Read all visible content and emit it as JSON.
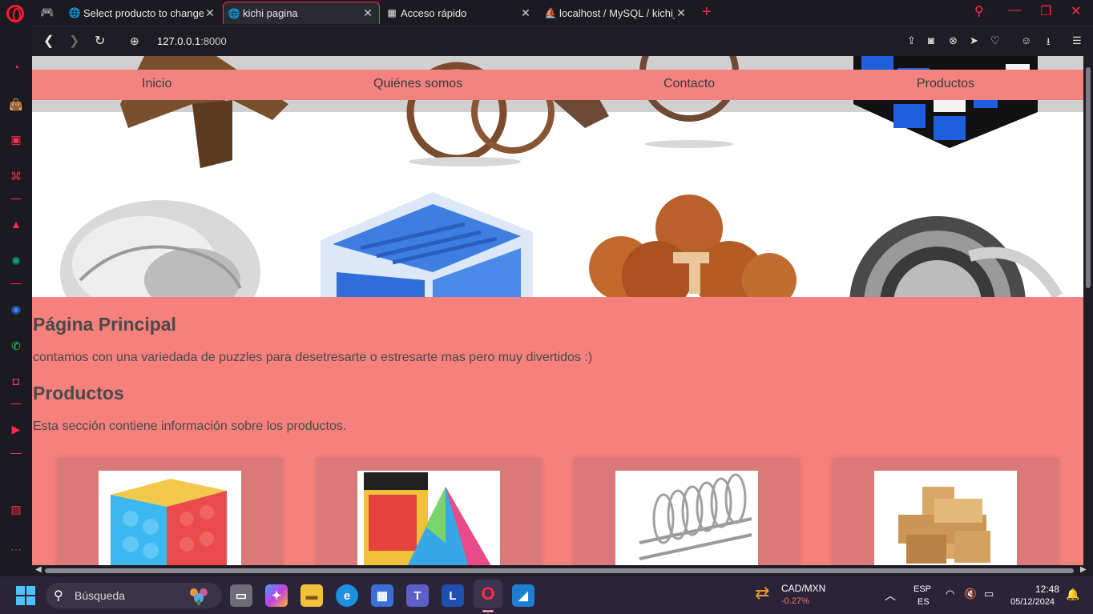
{
  "browser": {
    "tabs": [
      {
        "title": "Select producto to change",
        "favicon": "globe-icon",
        "active": false
      },
      {
        "title": "kichi pagina",
        "favicon": "globe-icon",
        "active": true
      },
      {
        "title": "Acceso rápido",
        "favicon": "grid-icon",
        "active": false
      },
      {
        "title": "localhost / MySQL / kichi_t",
        "favicon": "phpmyadmin-icon",
        "active": false
      }
    ],
    "url_host": "127.0.0.1",
    "url_port": ":8000"
  },
  "site": {
    "nav": [
      "Inicio",
      "Quiénes somos",
      "Contacto",
      "Productos"
    ],
    "main_heading": "Página Principal",
    "main_text": "contamos con una variedada de puzzles para desetresarte o estresarte mas pero muy divertidos :)",
    "products_heading": "Productos",
    "products_text": "Esta sección contiene información sobre los productos.",
    "products": [
      {
        "image": "rubiks-cube-image"
      },
      {
        "image": "pyraminx-image"
      },
      {
        "image": "metal-ring-puzzle-image"
      },
      {
        "image": "wooden-knot-puzzle-image"
      }
    ]
  },
  "taskbar": {
    "search_label": "Búsqueda",
    "currency_pair": "CAD/MXN",
    "currency_change": "-0.27%",
    "lang_top": "ESP",
    "lang_bottom": "ES",
    "time": "12:48",
    "date": "05/12/2024"
  },
  "colors": {
    "accent": "#ff2a4c",
    "page_background": "#f6807c",
    "navbar_background": "#f28380",
    "card_background": "#d97979"
  }
}
